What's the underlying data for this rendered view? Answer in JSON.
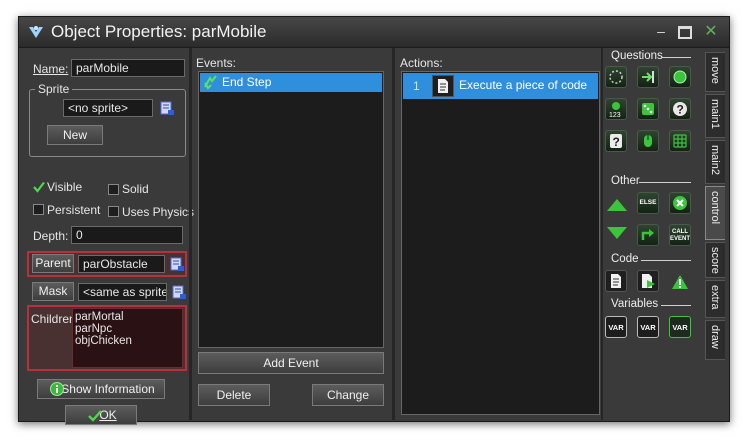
{
  "window": {
    "title": "Object Properties: parMobile"
  },
  "left": {
    "name_label": "Name:",
    "name_value": "parMobile",
    "sprite_group": "Sprite",
    "sprite_value": "<no sprite>",
    "new_button": "New",
    "visible_label": "Visible",
    "solid_label": "Solid",
    "persistent_label": "Persistent",
    "physics_label": "Uses Physics",
    "depth_label": "Depth:",
    "depth_value": "0",
    "parent_button": "Parent",
    "parent_value": "parObstacle",
    "mask_button": "Mask",
    "mask_value": "<same as sprite>",
    "children_label": "Children:",
    "children": [
      "parMortal",
      "parNpc",
      "objChicken"
    ],
    "show_info_button": "Show Information",
    "ok_button": "OK"
  },
  "checks": {
    "visible": true,
    "solid": false,
    "persistent": false,
    "physics": false
  },
  "events": {
    "label": "Events:",
    "items": [
      "End Step"
    ],
    "add_button": "Add Event",
    "delete_button": "Delete",
    "change_button": "Change"
  },
  "actions": {
    "label": "Actions:",
    "items": [
      {
        "number": "1",
        "text": "Execute a piece of code"
      }
    ]
  },
  "library": {
    "groups": {
      "questions": "Questions",
      "other": "Other",
      "code": "Code",
      "variables": "Variables"
    },
    "other_labels": {
      "else": "ELSE",
      "call_event_1": "CALL",
      "call_event_2": "EVENT"
    },
    "var_label": "VAR"
  },
  "tabs": [
    "move",
    "main1",
    "main2",
    "control",
    "score",
    "extra",
    "draw"
  ],
  "colors": {
    "selection": "#2f8fdc",
    "highlight_border": "#b4323c",
    "accent_green": "#3cc43c"
  }
}
